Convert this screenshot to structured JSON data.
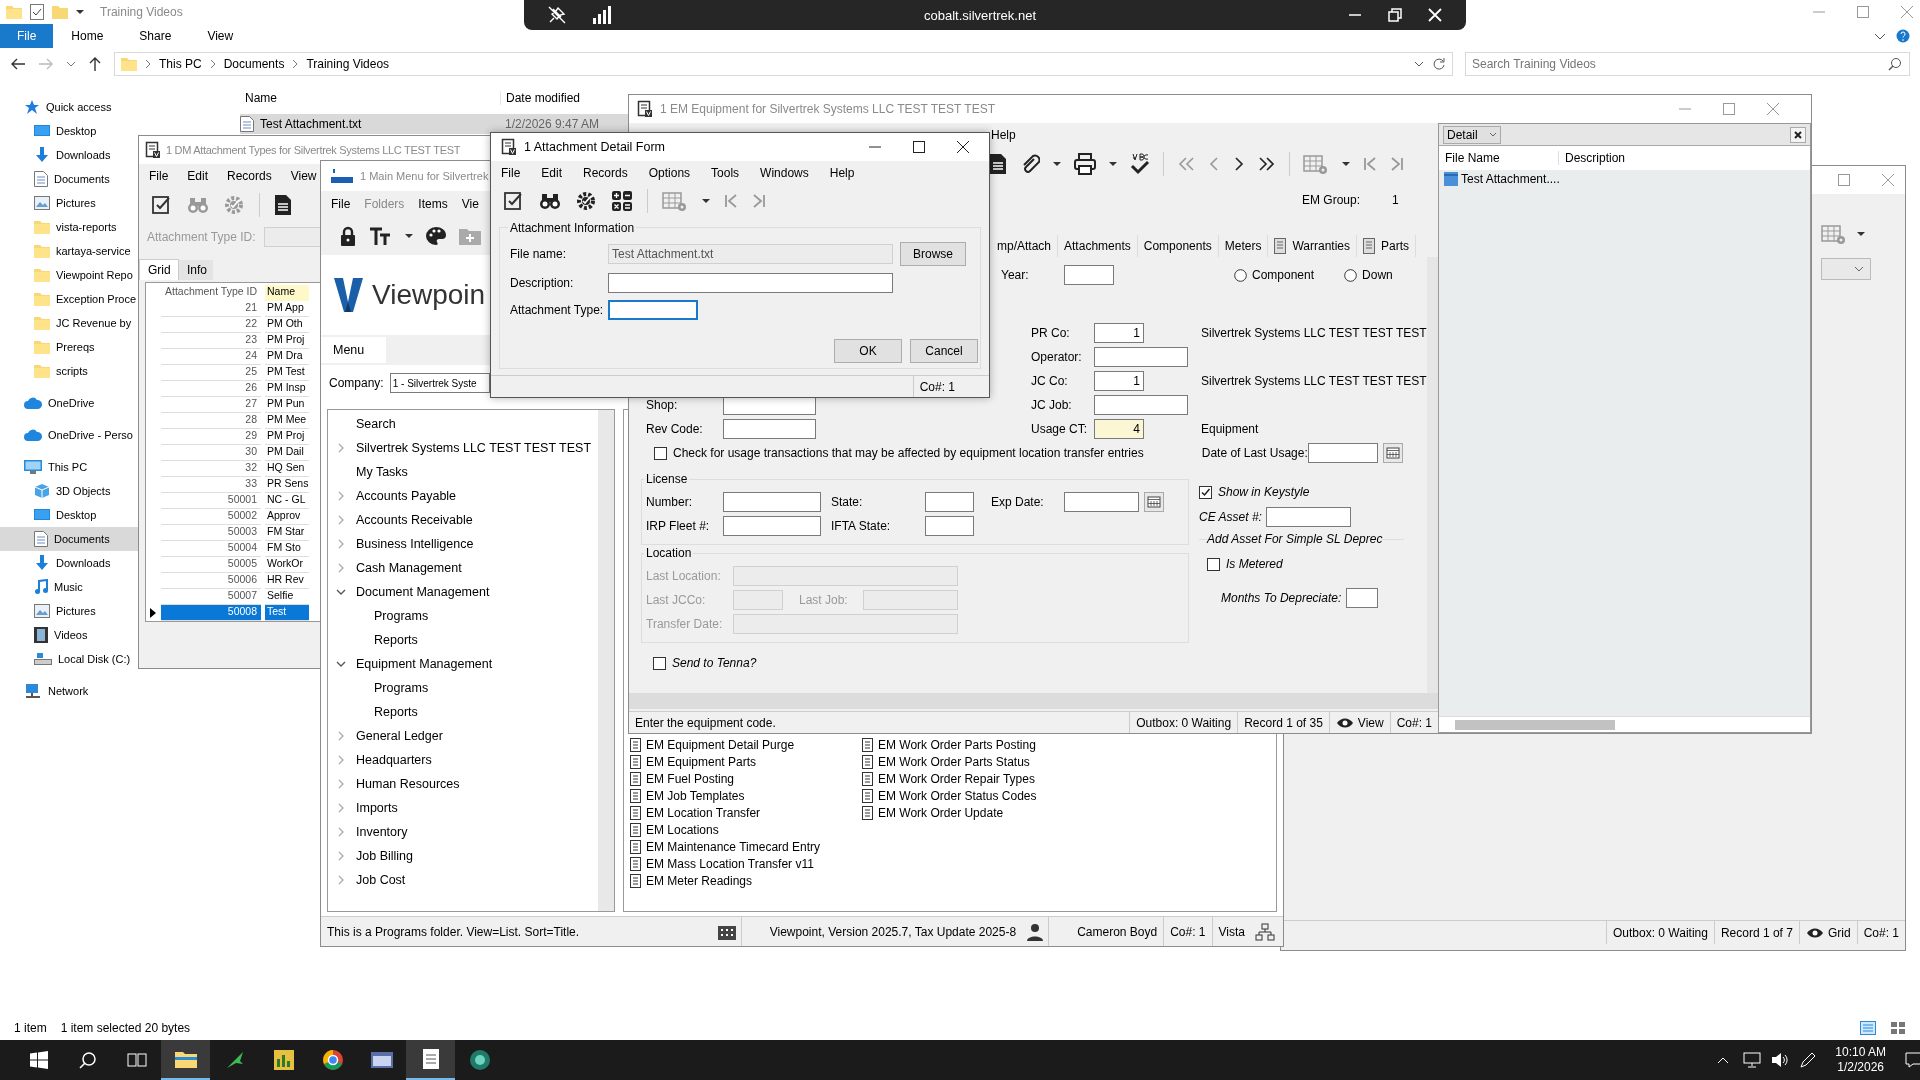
{
  "explorer": {
    "title": "Training Videos",
    "ribbon_tabs": [
      {
        "label": "File",
        "selected": true
      },
      {
        "label": "Home",
        "selected": false
      },
      {
        "label": "Share",
        "selected": false
      },
      {
        "label": "View",
        "selected": false
      }
    ],
    "breadcrumb": [
      "This PC",
      "Documents",
      "Training Videos"
    ],
    "search": {
      "placeholder": "Search Training Videos"
    },
    "nav": [
      {
        "label": "Quick access",
        "kind": "star",
        "selected": false,
        "children": [
          {
            "label": "Desktop",
            "kind": "desktop",
            "selected": false
          },
          {
            "label": "Downloads",
            "kind": "download",
            "selected": false
          },
          {
            "label": "Documents",
            "kind": "docs",
            "selected": false
          },
          {
            "label": "Pictures",
            "kind": "pictures",
            "selected": false
          },
          {
            "label": "vista-reports",
            "kind": "folder",
            "selected": false
          },
          {
            "label": "kartaya-service",
            "kind": "folder",
            "selected": false
          },
          {
            "label": "Viewpoint Repo",
            "kind": "folder",
            "selected": false
          },
          {
            "label": "Exception Proce",
            "kind": "folder",
            "selected": false
          },
          {
            "label": "JC Revenue by",
            "kind": "folder",
            "selected": false
          },
          {
            "label": "Prereqs",
            "kind": "folder",
            "selected": false
          },
          {
            "label": "scripts",
            "kind": "folder",
            "selected": false
          }
        ]
      },
      {
        "label": "OneDrive",
        "kind": "cloud",
        "selected": false
      },
      {
        "label": "OneDrive - Perso",
        "kind": "cloud",
        "selected": false
      },
      {
        "label": "This PC",
        "kind": "pc",
        "selected": false,
        "children": [
          {
            "label": "3D Objects",
            "kind": "cube",
            "selected": false
          },
          {
            "label": "Desktop",
            "kind": "desktop",
            "selected": false
          },
          {
            "label": "Documents",
            "kind": "docs",
            "selected": true
          },
          {
            "label": "Downloads",
            "kind": "download",
            "selected": false
          },
          {
            "label": "Music",
            "kind": "music",
            "selected": false
          },
          {
            "label": "Pictures",
            "kind": "pictures",
            "selected": false
          },
          {
            "label": "Videos",
            "kind": "video",
            "selected": false
          },
          {
            "label": "Local Disk (C:)",
            "kind": "disk",
            "selected": false
          }
        ]
      },
      {
        "label": "Network",
        "kind": "network",
        "selected": false
      }
    ],
    "columns": [
      "Name",
      "Date modified"
    ],
    "files": [
      {
        "name": "Test Attachment.txt",
        "date": "1/2/2026 9:47 AM",
        "selected": true
      }
    ],
    "status": [
      "1 item",
      "1 item selected 20 bytes"
    ]
  },
  "remote_bar": {
    "host": "cobalt.silvertrek.net"
  },
  "dm_window": {
    "title": "1 DM Attachment Types for Silvertrek Systems LLC TEST TEST",
    "menus": [
      "File",
      "Edit",
      "Records",
      "View"
    ],
    "field": {
      "label": "Attachment Type ID:"
    },
    "tabs": [
      {
        "label": "Grid",
        "selected": true
      },
      {
        "label": "Info",
        "selected": false
      }
    ],
    "columns": [
      "Attachment Type ID",
      "Name"
    ],
    "rows": [
      {
        "id": "21",
        "name": "PM App",
        "selected": false
      },
      {
        "id": "22",
        "name": "PM Oth",
        "selected": false
      },
      {
        "id": "23",
        "name": "PM Proj",
        "selected": false
      },
      {
        "id": "24",
        "name": "PM Dra",
        "selected": false
      },
      {
        "id": "25",
        "name": "PM Test",
        "selected": false
      },
      {
        "id": "26",
        "name": "PM Insp",
        "selected": false
      },
      {
        "id": "27",
        "name": "PM Pun",
        "selected": false
      },
      {
        "id": "28",
        "name": "PM Mee",
        "selected": false
      },
      {
        "id": "29",
        "name": "PM Proj",
        "selected": false
      },
      {
        "id": "30",
        "name": "PM Dail",
        "selected": false
      },
      {
        "id": "32",
        "name": "HQ Sen",
        "selected": false
      },
      {
        "id": "33",
        "name": "PR Sens",
        "selected": false
      },
      {
        "id": "50001",
        "name": "NC - GL",
        "selected": false
      },
      {
        "id": "50002",
        "name": "Approv",
        "selected": false
      },
      {
        "id": "50003",
        "name": "FM Star",
        "selected": false
      },
      {
        "id": "50004",
        "name": "FM Sto",
        "selected": false
      },
      {
        "id": "50005",
        "name": "WorkOr",
        "selected": false
      },
      {
        "id": "50006",
        "name": "HR Rev",
        "selected": false
      },
      {
        "id": "50007",
        "name": "Selfie",
        "selected": false
      },
      {
        "id": "50008",
        "name": "Test",
        "selected": true
      }
    ]
  },
  "main_menu": {
    "title": "1 Main Menu for Silvertrek",
    "menus": [
      {
        "label": "File",
        "disabled": false
      },
      {
        "label": "Folders",
        "disabled": true
      },
      {
        "label": "Items",
        "disabled": false
      },
      {
        "label": "Vie",
        "disabled": false
      }
    ],
    "logo_text": "Viewpoin",
    "tab": "Menu",
    "company": {
      "label": "Company:",
      "value": "1 - Silvertrek Syste"
    },
    "tree": [
      {
        "label": "Search"
      },
      {
        "label": "Silvertrek Systems LLC TEST TEST TEST",
        "expanded": false
      },
      {
        "label": "My Tasks"
      },
      {
        "label": "Accounts Payable",
        "expanded": false
      },
      {
        "label": "Accounts Receivable",
        "expanded": false
      },
      {
        "label": "Business Intelligence",
        "expanded": false
      },
      {
        "label": "Cash Management",
        "expanded": false
      },
      {
        "label": "Document Management",
        "expanded": true,
        "children": [
          {
            "label": "Programs"
          },
          {
            "label": "Reports"
          }
        ]
      },
      {
        "label": "Equipment Management",
        "expanded": true,
        "children": [
          {
            "label": "Programs"
          },
          {
            "label": "Reports"
          }
        ]
      },
      {
        "label": "General Ledger",
        "expanded": false
      },
      {
        "label": "Headquarters",
        "expanded": false
      },
      {
        "label": "Human Resources",
        "expanded": false
      },
      {
        "label": "Imports",
        "expanded": false
      },
      {
        "label": "Inventory",
        "expanded": false
      },
      {
        "label": "Job Billing",
        "expanded": false
      },
      {
        "label": "Job Cost",
        "expanded": false
      }
    ],
    "programs": [
      "EM Equipment Detail Purge",
      "EM Equipment Parts",
      "EM Fuel Posting",
      "EM Job Templates",
      "EM Location Transfer",
      "EM Locations",
      "EM Maintenance Timecard Entry",
      "EM Mass Location Transfer v11",
      "EM Meter Readings",
      "EM Work Order Parts Posting",
      "EM Work Order Parts Status",
      "EM Work Order Repair Types",
      "EM Work Order Status Codes",
      "EM Work Order Update"
    ],
    "status_bar": {
      "hint": "This is a Programs folder. View=List. Sort=Title.",
      "version": "Viewpoint, Version 2025.7, Tax Update 2025-8",
      "user": "Cameron Boyd",
      "company": "Co#: 1",
      "server": "Vista"
    }
  },
  "back_window": {
    "status_bar": {
      "outbox": "Outbox: 0 Waiting",
      "record": "Record 1 of 7",
      "mode": "Grid",
      "company": "Co#: 1"
    }
  },
  "em_window": {
    "title": "1 EM Equipment for Silvertrek Systems LLC TEST TEST TEST",
    "menus": [
      "Help"
    ],
    "em_group": {
      "label": "EM Group:",
      "value": "1"
    },
    "tabs": [
      {
        "label": "mp/Attach",
        "selected": false
      },
      {
        "label": "Attachments",
        "selected": false
      },
      {
        "label": "Components",
        "selected": false
      },
      {
        "label": "Meters",
        "selected": false
      },
      {
        "label": "Warranties",
        "selected": false
      },
      {
        "label": "Parts",
        "selected": false
      }
    ],
    "year": {
      "label": "Year:"
    },
    "status_radios": [
      {
        "label": "Component",
        "selected": false
      },
      {
        "label": "Down",
        "selected": false
      }
    ],
    "pr_co": {
      "label": "PR Co:",
      "value": "1",
      "description": "Silvertrek Systems LLC TEST TEST TEST"
    },
    "operator": {
      "label": "Operator:"
    },
    "jc_co": {
      "label": "JC Co:",
      "value": "1",
      "description": "Silvertrek Systems LLC TEST TEST TEST"
    },
    "shop": {
      "label": "Shop:"
    },
    "jc_job": {
      "label": "JC Job:"
    },
    "rev_code": {
      "label": "Rev Code:"
    },
    "usage_ct": {
      "label": "Usage CT:",
      "value": "4",
      "description": "Equipment"
    },
    "check_usage": {
      "label": "Check for usage transactions that may be affected by equipment location transfer entries",
      "checked": false
    },
    "date_last_usage": {
      "label": "Date of Last Usage:"
    },
    "license": {
      "title": "License",
      "number": {
        "label": "Number:"
      },
      "state": {
        "label": "State:"
      },
      "exp_date": {
        "label": "Exp Date:"
      },
      "irp_fleet": {
        "label": "IRP Fleet #:"
      },
      "ifta_state": {
        "label": "IFTA State:"
      }
    },
    "location": {
      "title": "Location",
      "last_location": {
        "label": "Last Location:",
        "disabled": true
      },
      "last_jcco": {
        "label": "Last JCCo:",
        "disabled": true
      },
      "last_job": {
        "label": "Last Job:",
        "disabled": true
      },
      "transfer_date": {
        "label": "Transfer Date:",
        "disabled": true
      }
    },
    "send_tenna": {
      "label": "Send to Tenna?",
      "checked": false
    },
    "show_keystyle": {
      "label": "Show in Keystyle",
      "checked": true
    },
    "ce_asset": {
      "label": "CE Asset #:"
    },
    "depreciation": {
      "title": "Add Asset For Simple SL Deprec",
      "is_metered": {
        "label": "Is Metered",
        "checked": false
      },
      "months": {
        "label": "Months To Depreciate:"
      }
    },
    "status_bar": {
      "hint": "Enter the equipment code.",
      "outbox": "Outbox: 0 Waiting",
      "record": "Record 1 of 35",
      "mode": "View",
      "company": "Co#: 1"
    },
    "attachments_panel": {
      "view": "Detail",
      "columns": [
        "File Name",
        "Description"
      ],
      "rows": [
        {
          "file_name": "Test Attachment...."
        }
      ]
    }
  },
  "attachment_form": {
    "title": "1 Attachment Detail Form",
    "menus": [
      "File",
      "Edit",
      "Records",
      "Options",
      "Tools",
      "Windows",
      "Help"
    ],
    "group": "Attachment Information",
    "file_name": {
      "label": "File name:",
      "value": "Test Attachment.txt",
      "disabled": true
    },
    "description": {
      "label": "Description:"
    },
    "attachment_type": {
      "label": "Attachment Type:",
      "focused": true
    },
    "browse": "Browse",
    "ok": "OK",
    "cancel": "Cancel",
    "status": "Co#: 1"
  },
  "taskbar": {
    "time": "10:10 AM",
    "date": "1/2/2026"
  }
}
